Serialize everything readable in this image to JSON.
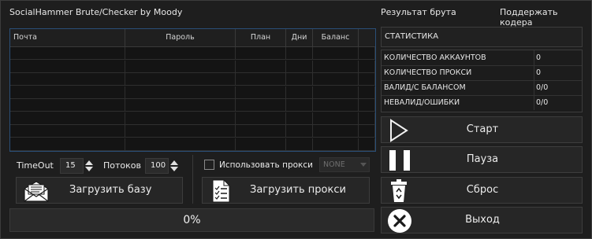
{
  "window": {
    "title": "SocialHammer Brute/Checker by Moody",
    "links": [
      "Результат брута",
      "Поддержать кодера"
    ]
  },
  "table": {
    "columns": [
      "Почта",
      "Пароль",
      "План",
      "Дни",
      "Баланс",
      ""
    ],
    "rows": [
      [
        "",
        "",
        "",
        "",
        "",
        ""
      ],
      [
        "",
        "",
        "",
        "",
        "",
        ""
      ],
      [
        "",
        "",
        "",
        "",
        "",
        ""
      ],
      [
        "",
        "",
        "",
        "",
        "",
        ""
      ],
      [
        "",
        "",
        "",
        "",
        "",
        ""
      ],
      [
        "",
        "",
        "",
        "",
        "",
        ""
      ],
      [
        "",
        "",
        "",
        "",
        "",
        ""
      ],
      [
        "",
        "",
        "",
        "",
        "",
        ""
      ]
    ]
  },
  "controls": {
    "timeout_label": "TimeOut",
    "timeout_value": "15",
    "threads_label": "Потоков",
    "threads_value": "100",
    "use_proxy_label": "Использовать прокси",
    "use_proxy_checked": false,
    "proxy_type": "NONE",
    "load_base_label": "Загрузить базу",
    "load_proxy_label": "Загрузить прокси"
  },
  "progress": {
    "value": 0,
    "text": "0%",
    "fill_color": "#3b6ea5"
  },
  "stats": {
    "header": "СТАТИСТИКА",
    "rows": [
      {
        "name": "КОЛИЧЕСТВО АККАУНТОВ",
        "value": "0"
      },
      {
        "name": "КОЛИЧЕСТВО ПРОКСИ",
        "value": "0"
      },
      {
        "name": "ВАЛИД/С БАЛАНСОМ",
        "value": "0/0"
      },
      {
        "name": "НЕВАЛИД/ОШИБКИ",
        "value": "0/0"
      }
    ]
  },
  "actions": {
    "start": "Старт",
    "pause": "Пауза",
    "reset": "Сброс",
    "exit": "Выход"
  },
  "icons": {
    "start": "play-icon",
    "pause": "pause-icon",
    "reset": "recycle-bin-icon",
    "exit": "close-circle-icon",
    "load_base": "envelope-icon",
    "load_proxy": "document-list-icon"
  }
}
